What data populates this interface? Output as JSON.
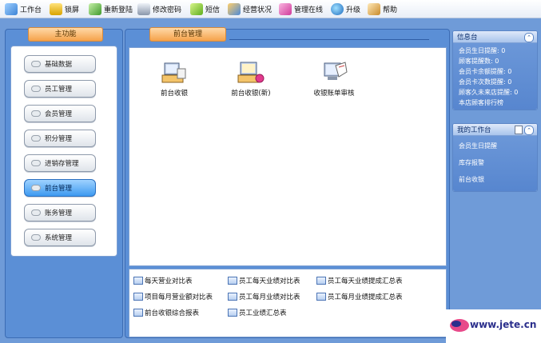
{
  "toolbar": {
    "items": [
      {
        "label": "工作台",
        "icon": "workbench-icon"
      },
      {
        "label": "锁屏",
        "icon": "lock-icon"
      },
      {
        "label": "重新登陆",
        "icon": "relogin-icon"
      },
      {
        "label": "修改密码",
        "icon": "keyboard-icon"
      },
      {
        "label": "短信",
        "icon": "sms-icon"
      },
      {
        "label": "经营状况",
        "icon": "business-icon"
      },
      {
        "label": "管理在线",
        "icon": "online-icon"
      },
      {
        "label": "升级",
        "icon": "globe-icon"
      },
      {
        "label": "帮助",
        "icon": "help-icon"
      }
    ]
  },
  "sidebar": {
    "title": "主功能",
    "items": [
      {
        "label": "基础数据"
      },
      {
        "label": "员工管理"
      },
      {
        "label": "会员管理"
      },
      {
        "label": "积分管理"
      },
      {
        "label": "进销存管理"
      },
      {
        "label": "前台管理"
      },
      {
        "label": "账务管理"
      },
      {
        "label": "系统管理"
      }
    ],
    "active": "前台管理"
  },
  "center": {
    "title": "前台管理",
    "functions": [
      {
        "label": "前台收银",
        "icon": "cashier-icon"
      },
      {
        "label": "前台收银(新)",
        "icon": "cashier-new-icon"
      },
      {
        "label": "收银账单审核",
        "icon": "bill-review-icon"
      }
    ],
    "reports": [
      {
        "label": "每天营业对比表"
      },
      {
        "label": "员工每天业绩对比表"
      },
      {
        "label": "员工每天业绩提成汇总表"
      },
      {
        "label": "项目每月营业额对比表"
      },
      {
        "label": "员工每月业绩对比表"
      },
      {
        "label": "员工每月业绩提成汇总表"
      },
      {
        "label": "前台收银综合报表"
      },
      {
        "label": "员工业绩汇总表"
      }
    ]
  },
  "info_panel": {
    "title": "信息台",
    "lines": [
      "会员生日提醒: 0",
      "顾客提醒数: 0",
      "会员卡余额提醒: 0",
      "会员卡次数提醒: 0",
      "顾客久未来店提醒: 0",
      "本店顾客排行榜"
    ]
  },
  "workbench_panel": {
    "title": "我的工作台",
    "links": [
      "会员生日提醒",
      "库存报警",
      "前台收银"
    ]
  },
  "watermark": {
    "text": "www.jete.cn"
  },
  "colors": {
    "frame_blue": "#6f9bd8",
    "tab_orange": "#f5a24a",
    "active_nav": "#3e9af0"
  }
}
